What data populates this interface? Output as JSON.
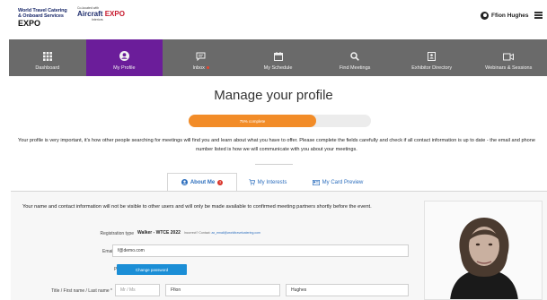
{
  "header": {
    "logo_primary_lines": [
      "World Travel Catering",
      "& Onboard Services"
    ],
    "logo_primary_expo": "EXPO",
    "logo_secondary_small": "Co-located with",
    "logo_secondary_name_a": "Aircraft ",
    "logo_secondary_name_b": "EXPO",
    "logo_secondary_sub": "Interiors",
    "user_name": "Ffion Hughes",
    "menu_icon": "hamburger-icon"
  },
  "nav": {
    "items": [
      {
        "label": "Dashboard",
        "icon": "grid-icon"
      },
      {
        "label": "My Profile",
        "icon": "user-circle-icon",
        "active": true
      },
      {
        "label": "Inbox",
        "icon": "chat-icon",
        "badge": true
      },
      {
        "label": "My Schedule",
        "icon": "calendar-icon"
      },
      {
        "label": "Find Meetings",
        "icon": "search-icon"
      },
      {
        "label": "Exhibitor Directory",
        "icon": "directory-icon"
      },
      {
        "label": "Webinars & Sessions",
        "icon": "video-icon"
      }
    ],
    "active_color": "#6b1d9a",
    "bar_color": "#6a6a6a"
  },
  "page": {
    "title": "Manage your profile",
    "progress_label": "75% complete",
    "progress_value": 0.7,
    "progress_color": "#f28c28",
    "intro": "Your profile is very important, it's how other people searching for meetings will find you and learn about what you have to offer. Please complete the fields carefully and check if all contact information is up to date - the email and phone number listed is how we will communicate with you about your meetings."
  },
  "tabs": [
    {
      "label": "About Me",
      "icon": "user-circle-icon",
      "active": true,
      "warning": "!"
    },
    {
      "label": "My Interests",
      "icon": "cart-icon"
    },
    {
      "label": "My Card Preview",
      "icon": "card-icon"
    }
  ],
  "form": {
    "note": "Your name and contact information will not be visible to other users and will only be made available to confirmed meeting partners shortly before the event.",
    "registration_type_label": "Registration type",
    "registration_type_value": "Walker - WTCE 2022",
    "registration_contact_label": "Incorrect? Contact:",
    "registration_contact_email": "ax_email@worldtravelcatering.com",
    "email_label": "Email address *",
    "email_value": "f@demo.com",
    "password_label": "Password",
    "password_button": "Change password",
    "name_label": "Title / First name / Last name *",
    "title_placeholder": "Mr / Ms",
    "first_name": "Ffion",
    "last_name": "Hughes"
  }
}
